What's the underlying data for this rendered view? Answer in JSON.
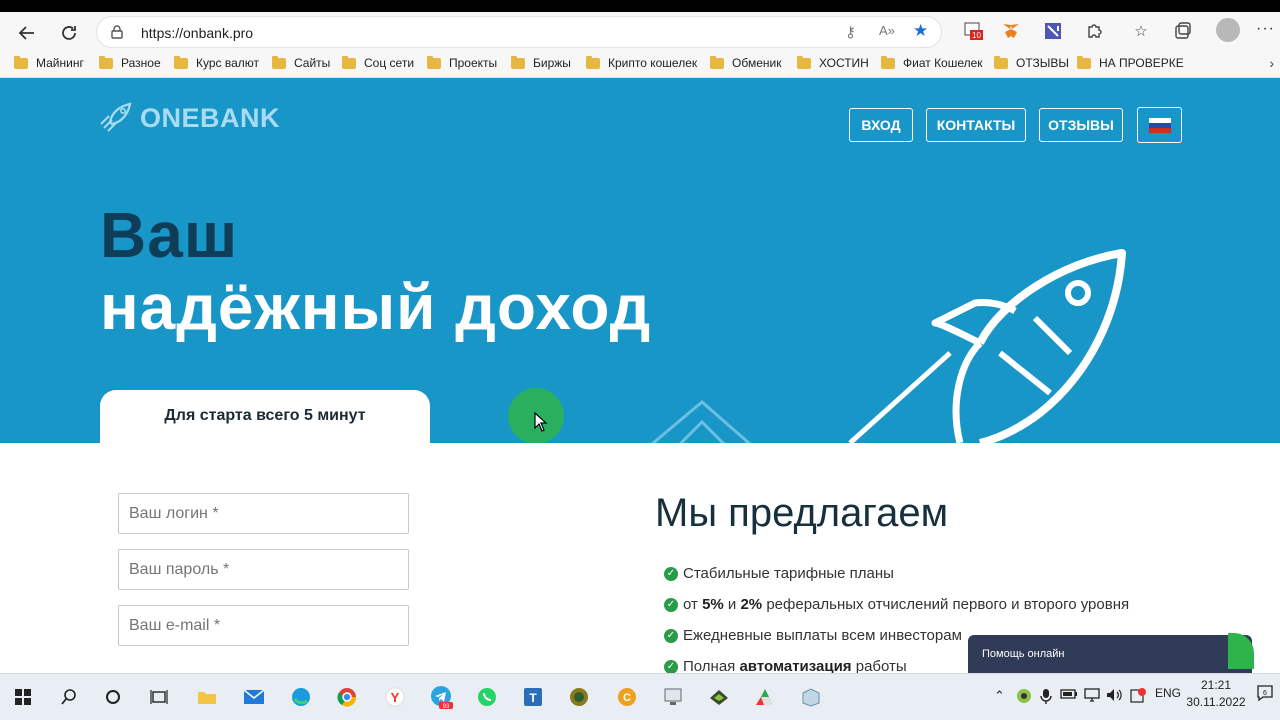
{
  "browser": {
    "url": "https://onbank.pro",
    "ext_badge": "10",
    "bookmarks": [
      "Майнинг",
      "Разное",
      "Курс валют",
      "Сайты",
      "Соц сети",
      "Проекты",
      "Биржы",
      "Крипто кошелек",
      "Обменик",
      "ХОСТИН",
      "Фиат Кошелек",
      "ОТЗЫВЫ",
      "НА ПРОВЕРКЕ"
    ]
  },
  "site": {
    "logo": "ONEBANK",
    "nav": {
      "login": "ВХОД",
      "contacts": "КОНТАКТЫ",
      "reviews": "ОТЗЫВЫ"
    },
    "hero_line1": "Ваш",
    "hero_line2": "надёжный доход",
    "start_tab": "Для старта всего 5 минут",
    "form": {
      "login_placeholder": "Ваш логин *",
      "password_placeholder": "Ваш пароль *",
      "email_placeholder": "Ваш e-mail *"
    },
    "offer": {
      "title": "Мы предлагаем",
      "item1": "Стабильные тарифные планы",
      "item2_pre": "от ",
      "item2_b1": "5%",
      "item2_mid": " и ",
      "item2_b2": "2%",
      "item2_post": " реферальных отчислений первого и второго уровня",
      "item3": "Ежедневные выплаты всем инвесторам",
      "item4_pre": "Полная ",
      "item4_b": "автоматизация",
      "item4_post": " работы"
    },
    "help_chat": "Помощь онлайн"
  },
  "taskbar": {
    "language": "ENG",
    "time": "21:21",
    "date": "30.11.2022",
    "telegram_badge": "93",
    "notif_count": "6"
  },
  "colors": {
    "hero_bg": "#1896c8",
    "title_dark": "#0e3d57",
    "check_green": "#2a9b47",
    "chat_bg": "#2f3b57"
  }
}
